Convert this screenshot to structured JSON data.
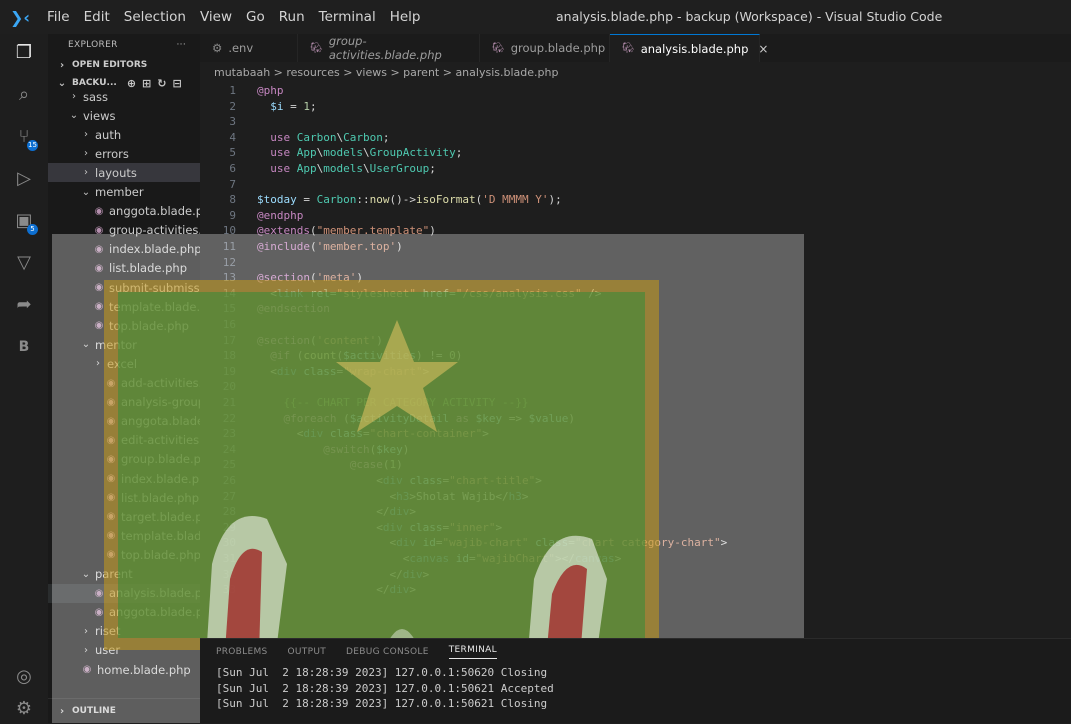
{
  "menu": {
    "items": [
      "File",
      "Edit",
      "Selection",
      "View",
      "Go",
      "Run",
      "Terminal",
      "Help"
    ],
    "window_title": "analysis.blade.php - backup (Workspace) - Visual Studio Code"
  },
  "activity_bar": {
    "badges": {
      "source_control": "15",
      "extensions": "5"
    },
    "letter_item": "B"
  },
  "explorer": {
    "header": "EXPLORER",
    "more": "···",
    "open_editors": "OPEN EDITORS",
    "workspace": "BACKU...",
    "outline": "OUTLINE",
    "tree": [
      {
        "label": "sass",
        "type": "folder",
        "open": false
      },
      {
        "label": "views",
        "type": "folder",
        "open": true
      },
      {
        "label": "auth",
        "type": "folder",
        "open": false
      },
      {
        "label": "errors",
        "type": "folder",
        "open": false
      },
      {
        "label": "layouts",
        "type": "folder",
        "open": false
      },
      {
        "label": "member",
        "type": "folder",
        "open": true
      },
      {
        "label": "anggota.blade.p...",
        "type": "file"
      },
      {
        "label": "group-activities....",
        "type": "file"
      },
      {
        "label": "index.blade.php",
        "type": "file"
      },
      {
        "label": "list.blade.php",
        "type": "file"
      },
      {
        "label": "submit-submissi...",
        "type": "file"
      },
      {
        "label": "template.blade....",
        "type": "file"
      },
      {
        "label": "top.blade.php",
        "type": "file"
      },
      {
        "label": "mentor",
        "type": "folder",
        "open": true
      },
      {
        "label": "excel",
        "type": "folder",
        "open": false
      },
      {
        "label": "add-activities.bl...",
        "type": "file"
      },
      {
        "label": "analysis-group....",
        "type": "file"
      },
      {
        "label": "anggota.blade.p...",
        "type": "file"
      },
      {
        "label": "edit-activities.bl...",
        "type": "file"
      },
      {
        "label": "group.blade.php",
        "type": "file"
      },
      {
        "label": "index.blade.php",
        "type": "file"
      },
      {
        "label": "list.blade.php",
        "type": "file"
      },
      {
        "label": "target.blade.php",
        "type": "file"
      },
      {
        "label": "template.blade....",
        "type": "file"
      },
      {
        "label": "top.blade.php",
        "type": "file"
      },
      {
        "label": "parent",
        "type": "folder",
        "open": true
      },
      {
        "label": "analysis.blade.p...",
        "type": "file",
        "active": true
      },
      {
        "label": "anggota.blade.p...",
        "type": "file"
      },
      {
        "label": "riset",
        "type": "folder",
        "open": false
      },
      {
        "label": "user",
        "type": "folder",
        "open": false
      },
      {
        "label": "home.blade.php",
        "type": "file"
      }
    ]
  },
  "tabs": [
    {
      "label": ".env",
      "icon": "gear-icon"
    },
    {
      "label": "group-activities.blade.php",
      "italic": true
    },
    {
      "label": "group.blade.php"
    },
    {
      "label": "analysis.blade.php",
      "active": true,
      "close": "×"
    }
  ],
  "breadcrumb": "mutabaah > resources > views > parent > analysis.blade.php",
  "editor": {
    "lines": [
      {
        "n": "1",
        "parts": [
          [
            "c-kw",
            "@php"
          ]
        ]
      },
      {
        "n": "2",
        "parts": [
          [
            "",
            "  "
          ],
          [
            "c-var",
            "$i"
          ],
          [
            "",
            " = "
          ],
          [
            "c-num",
            "1"
          ],
          [
            "",
            ";"
          ]
        ]
      },
      {
        "n": "3",
        "parts": []
      },
      {
        "n": "4",
        "parts": [
          [
            "",
            "  "
          ],
          [
            "c-kw",
            "use"
          ],
          [
            "",
            " "
          ],
          [
            "c-cls",
            "Carbon"
          ],
          [
            "",
            "\\"
          ],
          [
            "c-cls",
            "Carbon"
          ],
          [
            "",
            ";"
          ]
        ]
      },
      {
        "n": "5",
        "parts": [
          [
            "",
            "  "
          ],
          [
            "c-kw",
            "use"
          ],
          [
            "",
            " "
          ],
          [
            "c-cls",
            "App"
          ],
          [
            "",
            "\\"
          ],
          [
            "c-cls",
            "models"
          ],
          [
            "",
            "\\"
          ],
          [
            "c-cls",
            "GroupActivity"
          ],
          [
            "",
            ";"
          ]
        ]
      },
      {
        "n": "6",
        "parts": [
          [
            "",
            "  "
          ],
          [
            "c-kw",
            "use"
          ],
          [
            "",
            " "
          ],
          [
            "c-cls",
            "App"
          ],
          [
            "",
            "\\"
          ],
          [
            "c-cls",
            "models"
          ],
          [
            "",
            "\\"
          ],
          [
            "c-cls",
            "UserGroup"
          ],
          [
            "",
            ";"
          ]
        ]
      },
      {
        "n": "7",
        "parts": []
      },
      {
        "n": "8",
        "parts": [
          [
            "c-var",
            "$today"
          ],
          [
            "",
            " = "
          ],
          [
            "c-cls",
            "Carbon"
          ],
          [
            "",
            "::"
          ],
          [
            "c-fn",
            "now"
          ],
          [
            "",
            "()->"
          ],
          [
            "c-fn",
            "isoFormat"
          ],
          [
            "",
            "("
          ],
          [
            "c-str",
            "'D MMMM Y'"
          ],
          [
            "",
            ");"
          ]
        ]
      },
      {
        "n": "9",
        "parts": [
          [
            "c-kw",
            "@endphp"
          ]
        ]
      },
      {
        "n": "10",
        "parts": [
          [
            "c-kw",
            "@extends"
          ],
          [
            "",
            "("
          ],
          [
            "c-str",
            "\"member.template\""
          ],
          [
            "",
            ")"
          ]
        ]
      },
      {
        "n": "11",
        "parts": [
          [
            "c-kw",
            "@include"
          ],
          [
            "",
            "("
          ],
          [
            "c-str",
            "'member.top'"
          ],
          [
            "",
            ")"
          ]
        ]
      },
      {
        "n": "12",
        "parts": []
      },
      {
        "n": "13",
        "parts": [
          [
            "c-kw",
            "@section"
          ],
          [
            "",
            "("
          ],
          [
            "c-str",
            "'meta'"
          ],
          [
            "",
            ")"
          ]
        ]
      },
      {
        "n": "14",
        "parts": [
          [
            "",
            "  <"
          ],
          [
            "c-tag",
            "link"
          ],
          [
            "",
            " "
          ],
          [
            "c-attr",
            "rel"
          ],
          [
            "",
            "="
          ],
          [
            "c-str",
            "\"stylesheet\""
          ],
          [
            "",
            " "
          ],
          [
            "c-attr",
            "href"
          ],
          [
            "",
            "="
          ],
          [
            "c-str",
            "\"/css/analysis.css\""
          ],
          [
            "",
            " />"
          ]
        ]
      },
      {
        "n": "15",
        "parts": [
          [
            "c-kw",
            "@endsection"
          ]
        ]
      },
      {
        "n": "16",
        "parts": []
      },
      {
        "n": "17",
        "parts": [
          [
            "c-kw",
            "@section"
          ],
          [
            "",
            "("
          ],
          [
            "c-str",
            "'content'"
          ],
          [
            "",
            ")"
          ]
        ]
      },
      {
        "n": "18",
        "parts": [
          [
            "",
            "  "
          ],
          [
            "c-kw",
            "@if"
          ],
          [
            "",
            " ("
          ],
          [
            "c-fn",
            "count"
          ],
          [
            "",
            "("
          ],
          [
            "c-var",
            "$activities"
          ],
          [
            "",
            ") != "
          ],
          [
            "c-num",
            "0"
          ],
          [
            "",
            ")"
          ]
        ]
      },
      {
        "n": "19",
        "parts": [
          [
            "",
            "  <"
          ],
          [
            "c-tag",
            "div"
          ],
          [
            "",
            " "
          ],
          [
            "c-attr",
            "class"
          ],
          [
            "",
            "="
          ],
          [
            "c-str",
            "\"wrap-chart\""
          ],
          [
            "",
            ">"
          ]
        ]
      },
      {
        "n": "20",
        "parts": []
      },
      {
        "n": "21",
        "parts": [
          [
            "",
            "    "
          ],
          [
            "c-cm",
            "{{-- CHART PER CATEGORY ACTIVITY --}}"
          ]
        ]
      },
      {
        "n": "22",
        "parts": [
          [
            "",
            "    "
          ],
          [
            "c-kw",
            "@foreach"
          ],
          [
            "",
            " ("
          ],
          [
            "c-var",
            "$activityDetail"
          ],
          [
            "",
            " "
          ],
          [
            "c-kw",
            "as"
          ],
          [
            "",
            " "
          ],
          [
            "c-var",
            "$key"
          ],
          [
            "",
            " => "
          ],
          [
            "c-var",
            "$value"
          ],
          [
            "",
            ")"
          ]
        ]
      },
      {
        "n": "23",
        "parts": [
          [
            "",
            "      <"
          ],
          [
            "c-tag",
            "div"
          ],
          [
            "",
            " "
          ],
          [
            "c-attr",
            "class"
          ],
          [
            "",
            "="
          ],
          [
            "c-str",
            "\"chart-container\""
          ],
          [
            "",
            ">"
          ]
        ]
      },
      {
        "n": "24",
        "parts": [
          [
            "",
            "          "
          ],
          [
            "c-kw",
            "@switch"
          ],
          [
            "",
            "("
          ],
          [
            "c-var",
            "$key"
          ],
          [
            "",
            ")"
          ]
        ]
      },
      {
        "n": "25",
        "parts": [
          [
            "",
            "              "
          ],
          [
            "c-kw",
            "@case"
          ],
          [
            "",
            "("
          ],
          [
            "c-num",
            "1"
          ],
          [
            "",
            ")"
          ]
        ]
      },
      {
        "n": "26",
        "parts": [
          [
            "",
            "                  <"
          ],
          [
            "c-tag",
            "div"
          ],
          [
            "",
            " "
          ],
          [
            "c-attr",
            "class"
          ],
          [
            "",
            "="
          ],
          [
            "c-str",
            "\"chart-title\""
          ],
          [
            "",
            ">"
          ]
        ]
      },
      {
        "n": "27",
        "parts": [
          [
            "",
            "                    <"
          ],
          [
            "c-tag",
            "h3"
          ],
          [
            "",
            ">Sholat Wajib</"
          ],
          [
            "c-tag",
            "h3"
          ],
          [
            "",
            ">"
          ]
        ]
      },
      {
        "n": "28",
        "parts": [
          [
            "",
            "                  </"
          ],
          [
            "c-tag",
            "div"
          ],
          [
            "",
            ">"
          ]
        ]
      },
      {
        "n": "29",
        "parts": [
          [
            "",
            "                  <"
          ],
          [
            "c-tag",
            "div"
          ],
          [
            "",
            " "
          ],
          [
            "c-attr",
            "class"
          ],
          [
            "",
            "="
          ],
          [
            "c-str",
            "\"inner\""
          ],
          [
            "",
            ">"
          ]
        ]
      },
      {
        "n": "30",
        "parts": [
          [
            "",
            "                    <"
          ],
          [
            "c-tag",
            "div"
          ],
          [
            "",
            " "
          ],
          [
            "c-attr",
            "id"
          ],
          [
            "",
            "="
          ],
          [
            "c-str",
            "\"wajib-chart\""
          ],
          [
            "",
            " "
          ],
          [
            "c-attr",
            "class"
          ],
          [
            "",
            "="
          ],
          [
            "c-str",
            "\"chart category-chart\""
          ],
          [
            "",
            ">"
          ]
        ]
      },
      {
        "n": "31",
        "parts": [
          [
            "",
            "                      <"
          ],
          [
            "c-tag",
            "canvas"
          ],
          [
            "",
            " "
          ],
          [
            "c-attr",
            "id"
          ],
          [
            "",
            "="
          ],
          [
            "c-str",
            "\"wajibChart\""
          ],
          [
            "",
            "></"
          ],
          [
            "c-tag",
            "canvas"
          ],
          [
            "",
            ">"
          ]
        ]
      },
      {
        "n": "32",
        "parts": [
          [
            "",
            "                    </"
          ],
          [
            "c-tag",
            "div"
          ],
          [
            "",
            ">"
          ]
        ]
      },
      {
        "n": "33",
        "parts": [
          [
            "",
            "                  </"
          ],
          [
            "c-tag",
            "div"
          ],
          [
            "",
            ">"
          ]
        ]
      }
    ]
  },
  "panel": {
    "tabs": [
      "PROBLEMS",
      "OUTPUT",
      "DEBUG CONSOLE",
      "TERMINAL"
    ],
    "active_tab": "TERMINAL",
    "terminal_lines": [
      "[Sun Jul  2 18:28:39 2023] 127.0.0.1:50620 Closing",
      "[Sun Jul  2 18:28:39 2023] 127.0.0.1:50621 Accepted",
      "[Sun Jul  2 18:28:39 2023] 127.0.0.1:50621 Closing"
    ]
  }
}
